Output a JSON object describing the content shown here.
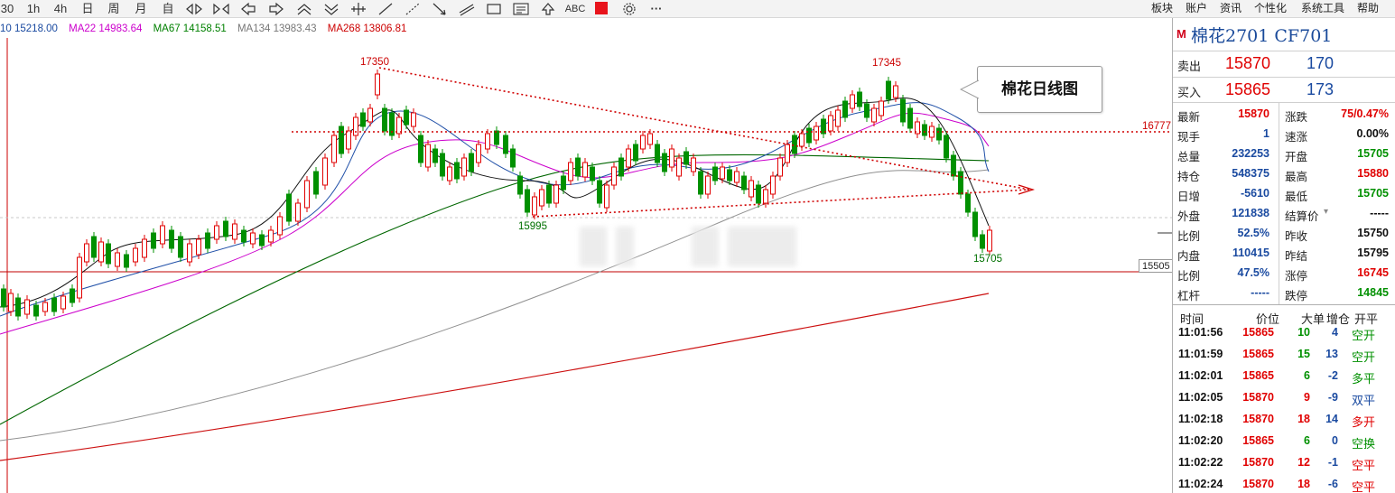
{
  "toolbar": {
    "tools": [
      {
        "label": "30",
        "icon": ""
      },
      {
        "label": "1h",
        "icon": ""
      },
      {
        "label": "4h",
        "icon": ""
      },
      {
        "label": "日",
        "icon": ""
      },
      {
        "label": "周",
        "icon": ""
      },
      {
        "label": "月",
        "icon": ""
      },
      {
        "label": "自",
        "icon": ""
      }
    ],
    "icon_tools": [
      "zoom-in-icon",
      "zoom-out-icon",
      "arrow-left-icon",
      "arrow-right-icon",
      "arrow-up-double-icon",
      "arrow-down-double-icon",
      "crosshair-icon",
      "line-tool-icon",
      "ray-tool-icon",
      "arrow-line-icon",
      "parallel-line-icon",
      "rectangle-icon",
      "text-box-icon",
      "up-arrow-icon"
    ],
    "abc_label": "ABC",
    "menus": [
      "板块",
      "账户",
      "资讯",
      "个性化",
      "系统工具",
      "帮助"
    ]
  },
  "legend": {
    "items": [
      {
        "text": "10  15218.00",
        "color": "#1a4aa0"
      },
      {
        "text": "MA22  14983.64",
        "color": "#cc00cc"
      },
      {
        "text": "MA67  14158.51",
        "color": "#008000"
      },
      {
        "text": "MA134  13983.43",
        "color": "#777777"
      },
      {
        "text": "MA268  13806.81",
        "color": "#cc0000"
      }
    ]
  },
  "annotations": {
    "high_left": "17350",
    "high_right": "17345",
    "low_mid": "15995",
    "low_right": "15705",
    "level_resistance": "16777",
    "level_current": "15505",
    "note": "棉花日线图"
  },
  "panel": {
    "title_icon": "M",
    "title": "棉花2701  CF701",
    "sell": {
      "label": "卖出",
      "price": "15870",
      "qty": "170"
    },
    "buy": {
      "label": "买入",
      "price": "15865",
      "qty": "173"
    },
    "stats": [
      {
        "l1": "最新",
        "v1": "15870",
        "c1": "red",
        "l2": "涨跌",
        "v2": "75/0.47%",
        "c2": "red"
      },
      {
        "l1": "现手",
        "v1": "1",
        "c1": "blue",
        "l2": "速涨",
        "v2": "0.00%",
        "c2": "black"
      },
      {
        "l1": "总量",
        "v1": "232253",
        "c1": "blue",
        "l2": "开盘",
        "v2": "15705",
        "c2": "green"
      },
      {
        "l1": "持仓",
        "v1": "548375",
        "c1": "blue",
        "l2": "最高",
        "v2": "15880",
        "c2": "red"
      },
      {
        "l1": "日增",
        "v1": "-5610",
        "c1": "blue",
        "l2": "最低",
        "v2": "15705",
        "c2": "green"
      },
      {
        "l1": "外盘",
        "v1": "121838",
        "c1": "blue",
        "l2": "结算价",
        "v2": "-----",
        "c2": "black"
      },
      {
        "l1": "比例",
        "v1": "52.5%",
        "c1": "blue",
        "l2": "昨收",
        "v2": "15750",
        "c2": "black"
      },
      {
        "l1": "内盘",
        "v1": "110415",
        "c1": "blue",
        "l2": "昨结",
        "v2": "15795",
        "c2": "black"
      },
      {
        "l1": "比例",
        "v1": "47.5%",
        "c1": "blue",
        "l2": "涨停",
        "v2": "16745",
        "c2": "red"
      },
      {
        "l1": "杠杆",
        "v1": "-----",
        "c1": "blue",
        "l2": "跌停",
        "v2": "14845",
        "c2": "green"
      }
    ],
    "trades_header": {
      "time": "时间",
      "price": "价位",
      "vol": "大单",
      "oi": "增仓",
      "type": "开平"
    },
    "trades": [
      {
        "time": "11:01:56",
        "price": "15865",
        "pc": "red",
        "vol": "10",
        "vc": "green",
        "oi": "4",
        "type": "空开",
        "tc": "green"
      },
      {
        "time": "11:01:59",
        "price": "15865",
        "pc": "red",
        "vol": "15",
        "vc": "green",
        "oi": "13",
        "type": "空开",
        "tc": "green"
      },
      {
        "time": "11:02:01",
        "price": "15865",
        "pc": "red",
        "vol": "6",
        "vc": "green",
        "oi": "-2",
        "type": "多平",
        "tc": "green"
      },
      {
        "time": "11:02:05",
        "price": "15870",
        "pc": "red",
        "vol": "9",
        "vc": "red",
        "oi": "-9",
        "type": "双平",
        "tc": "blue"
      },
      {
        "time": "11:02:18",
        "price": "15870",
        "pc": "red",
        "vol": "18",
        "vc": "red",
        "oi": "14",
        "type": "多开",
        "tc": "red"
      },
      {
        "time": "11:02:20",
        "price": "15865",
        "pc": "red",
        "vol": "6",
        "vc": "green",
        "oi": "0",
        "type": "空换",
        "tc": "green"
      },
      {
        "time": "11:02:22",
        "price": "15870",
        "pc": "red",
        "vol": "12",
        "vc": "red",
        "oi": "-1",
        "type": "空平",
        "tc": "red"
      },
      {
        "time": "11:02:24",
        "price": "15870",
        "pc": "red",
        "vol": "18",
        "vc": "red",
        "oi": "-6",
        "type": "空平",
        "tc": "red"
      }
    ]
  }
}
